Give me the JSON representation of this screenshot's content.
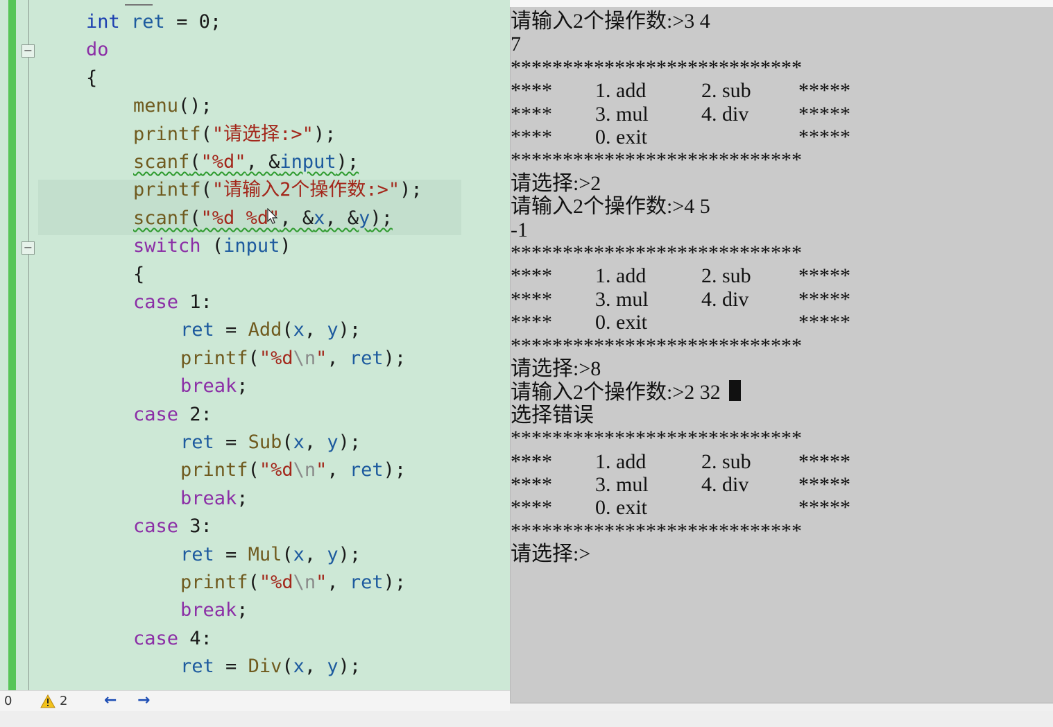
{
  "editor": {
    "lines": [
      {
        "indent": 2,
        "tokens": [
          {
            "c": "kw",
            "t": "int"
          },
          {
            "c": "",
            "t": " "
          },
          {
            "c": "var",
            "t": "ret"
          },
          {
            "c": "",
            "t": " = 0;"
          }
        ]
      },
      {
        "indent": 2,
        "tokens": [
          {
            "c": "ctl",
            "t": "do"
          }
        ]
      },
      {
        "indent": 2,
        "tokens": [
          {
            "c": "",
            "t": "{"
          }
        ]
      },
      {
        "indent": 3,
        "tokens": [
          {
            "c": "fn",
            "t": "menu"
          },
          {
            "c": "",
            "t": "();"
          }
        ]
      },
      {
        "indent": 3,
        "tokens": [
          {
            "c": "fn",
            "t": "printf"
          },
          {
            "c": "",
            "t": "("
          },
          {
            "c": "str",
            "t": "\"请选择:>\""
          },
          {
            "c": "",
            "t": ");"
          }
        ]
      },
      {
        "indent": 3,
        "squig": true,
        "tokens": [
          {
            "c": "fn",
            "t": "scanf"
          },
          {
            "c": "",
            "t": "("
          },
          {
            "c": "str",
            "t": "\"%d\""
          },
          {
            "c": "",
            "t": ", &"
          },
          {
            "c": "var",
            "t": "input"
          },
          {
            "c": "",
            "t": ");"
          }
        ]
      },
      {
        "indent": 3,
        "tokens": [
          {
            "c": "fn",
            "t": "printf"
          },
          {
            "c": "",
            "t": "("
          },
          {
            "c": "str",
            "t": "\"请输入2个操作数:>\""
          },
          {
            "c": "",
            "t": ");"
          }
        ]
      },
      {
        "indent": 3,
        "squig": true,
        "tokens": [
          {
            "c": "fn",
            "t": "scanf"
          },
          {
            "c": "",
            "t": "("
          },
          {
            "c": "str",
            "t": "\"%d %d\""
          },
          {
            "c": "",
            "t": ", &"
          },
          {
            "c": "var",
            "t": "x"
          },
          {
            "c": "",
            "t": ", &"
          },
          {
            "c": "var",
            "t": "y"
          },
          {
            "c": "",
            "t": ");"
          }
        ]
      },
      {
        "indent": 3,
        "tokens": [
          {
            "c": "ctl",
            "t": "switch"
          },
          {
            "c": "",
            "t": " ("
          },
          {
            "c": "var",
            "t": "input"
          },
          {
            "c": "",
            "t": ")"
          }
        ]
      },
      {
        "indent": 3,
        "tokens": [
          {
            "c": "",
            "t": "{"
          }
        ]
      },
      {
        "indent": 3,
        "tokens": [
          {
            "c": "ctl",
            "t": "case"
          },
          {
            "c": "",
            "t": " 1:"
          }
        ]
      },
      {
        "indent": 4,
        "tokens": [
          {
            "c": "var",
            "t": "ret"
          },
          {
            "c": "",
            "t": " = "
          },
          {
            "c": "fn",
            "t": "Add"
          },
          {
            "c": "",
            "t": "("
          },
          {
            "c": "var",
            "t": "x"
          },
          {
            "c": "",
            "t": ", "
          },
          {
            "c": "var",
            "t": "y"
          },
          {
            "c": "",
            "t": ");"
          }
        ]
      },
      {
        "indent": 4,
        "tokens": [
          {
            "c": "fn",
            "t": "printf"
          },
          {
            "c": "",
            "t": "("
          },
          {
            "c": "str",
            "t": "\"%d"
          },
          {
            "c": "esc",
            "t": "\\n"
          },
          {
            "c": "str",
            "t": "\""
          },
          {
            "c": "",
            "t": ", "
          },
          {
            "c": "var",
            "t": "ret"
          },
          {
            "c": "",
            "t": ");"
          }
        ]
      },
      {
        "indent": 4,
        "tokens": [
          {
            "c": "ctl",
            "t": "break"
          },
          {
            "c": "",
            "t": ";"
          }
        ]
      },
      {
        "indent": 3,
        "tokens": [
          {
            "c": "ctl",
            "t": "case"
          },
          {
            "c": "",
            "t": " 2:"
          }
        ]
      },
      {
        "indent": 4,
        "tokens": [
          {
            "c": "var",
            "t": "ret"
          },
          {
            "c": "",
            "t": " = "
          },
          {
            "c": "fn",
            "t": "Sub"
          },
          {
            "c": "",
            "t": "("
          },
          {
            "c": "var",
            "t": "x"
          },
          {
            "c": "",
            "t": ", "
          },
          {
            "c": "var",
            "t": "y"
          },
          {
            "c": "",
            "t": ");"
          }
        ]
      },
      {
        "indent": 4,
        "tokens": [
          {
            "c": "fn",
            "t": "printf"
          },
          {
            "c": "",
            "t": "("
          },
          {
            "c": "str",
            "t": "\"%d"
          },
          {
            "c": "esc",
            "t": "\\n"
          },
          {
            "c": "str",
            "t": "\""
          },
          {
            "c": "",
            "t": ", "
          },
          {
            "c": "var",
            "t": "ret"
          },
          {
            "c": "",
            "t": ");"
          }
        ]
      },
      {
        "indent": 4,
        "tokens": [
          {
            "c": "ctl",
            "t": "break"
          },
          {
            "c": "",
            "t": ";"
          }
        ]
      },
      {
        "indent": 3,
        "tokens": [
          {
            "c": "ctl",
            "t": "case"
          },
          {
            "c": "",
            "t": " 3:"
          }
        ]
      },
      {
        "indent": 4,
        "tokens": [
          {
            "c": "var",
            "t": "ret"
          },
          {
            "c": "",
            "t": " = "
          },
          {
            "c": "fn",
            "t": "Mul"
          },
          {
            "c": "",
            "t": "("
          },
          {
            "c": "var",
            "t": "x"
          },
          {
            "c": "",
            "t": ", "
          },
          {
            "c": "var",
            "t": "y"
          },
          {
            "c": "",
            "t": ");"
          }
        ]
      },
      {
        "indent": 4,
        "tokens": [
          {
            "c": "fn",
            "t": "printf"
          },
          {
            "c": "",
            "t": "("
          },
          {
            "c": "str",
            "t": "\"%d"
          },
          {
            "c": "esc",
            "t": "\\n"
          },
          {
            "c": "str",
            "t": "\""
          },
          {
            "c": "",
            "t": ", "
          },
          {
            "c": "var",
            "t": "ret"
          },
          {
            "c": "",
            "t": ");"
          }
        ]
      },
      {
        "indent": 4,
        "tokens": [
          {
            "c": "ctl",
            "t": "break"
          },
          {
            "c": "",
            "t": ";"
          }
        ]
      },
      {
        "indent": 3,
        "tokens": [
          {
            "c": "ctl",
            "t": "case"
          },
          {
            "c": "",
            "t": " 4:"
          }
        ]
      },
      {
        "indent": 4,
        "tokens": [
          {
            "c": "var",
            "t": "ret"
          },
          {
            "c": "",
            "t": " = "
          },
          {
            "c": "fn",
            "t": "Div"
          },
          {
            "c": "",
            "t": "("
          },
          {
            "c": "var",
            "t": "x"
          },
          {
            "c": "",
            "t": ", "
          },
          {
            "c": "var",
            "t": "y"
          },
          {
            "c": "",
            "t": ");"
          }
        ]
      }
    ],
    "fold_marker": "−"
  },
  "statusbar": {
    "errors_count": "0",
    "warnings_count": "2",
    "warning_icon": "warning-icon",
    "nav_back": "←",
    "nav_forward": "→"
  },
  "console": {
    "lines": [
      {
        "kind": "text",
        "text": "请输入2个操作数:>3 4"
      },
      {
        "kind": "text",
        "text": "7"
      },
      {
        "kind": "stars",
        "text": "****************************"
      },
      {
        "kind": "menu",
        "cells": [
          "****",
          "1. add",
          "2. sub",
          "*****"
        ]
      },
      {
        "kind": "menu",
        "cells": [
          "****",
          "3. mul",
          "4. div",
          "*****"
        ]
      },
      {
        "kind": "menu",
        "cells": [
          "****",
          "0. exit",
          "",
          "*****"
        ]
      },
      {
        "kind": "stars",
        "text": "****************************"
      },
      {
        "kind": "text",
        "text": "请选择:>2"
      },
      {
        "kind": "text",
        "text": "请输入2个操作数:>4 5"
      },
      {
        "kind": "text",
        "text": "-1"
      },
      {
        "kind": "stars",
        "text": "****************************"
      },
      {
        "kind": "menu",
        "cells": [
          "****",
          "1. add",
          "2. sub",
          "*****"
        ]
      },
      {
        "kind": "menu",
        "cells": [
          "****",
          "3. mul",
          "4. div",
          "*****"
        ]
      },
      {
        "kind": "menu",
        "cells": [
          "****",
          "0. exit",
          "",
          "*****"
        ]
      },
      {
        "kind": "stars",
        "text": "****************************"
      },
      {
        "kind": "text",
        "text": "请选择:>8"
      },
      {
        "kind": "text",
        "text": "请输入2个操作数:>2 32",
        "cursor": true
      },
      {
        "kind": "text",
        "text": "选择错误"
      },
      {
        "kind": "stars",
        "text": "****************************"
      },
      {
        "kind": "menu",
        "cells": [
          "****",
          "1. add",
          "2. sub",
          "*****"
        ]
      },
      {
        "kind": "menu",
        "cells": [
          "****",
          "3. mul",
          "4. div",
          "*****"
        ]
      },
      {
        "kind": "menu",
        "cells": [
          "****",
          "0. exit",
          "",
          "*****"
        ]
      },
      {
        "kind": "stars",
        "text": "****************************"
      },
      {
        "kind": "text",
        "text": "请选择:>"
      }
    ]
  }
}
